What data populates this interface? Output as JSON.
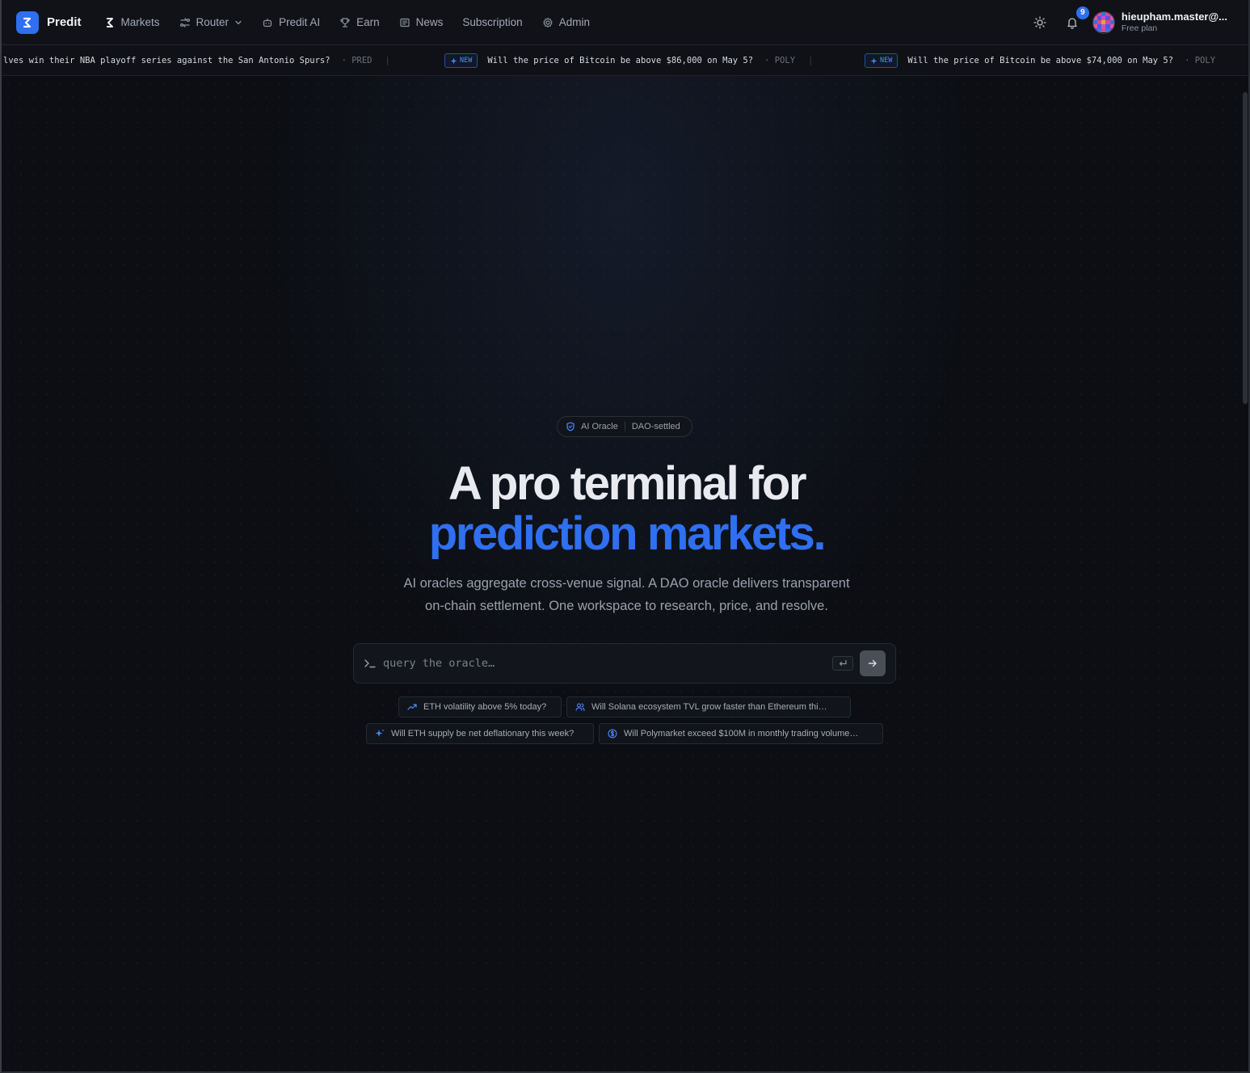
{
  "brand": {
    "name": "Predit",
    "color": "#2f6ff0"
  },
  "nav": {
    "items": [
      {
        "label": "Markets",
        "icon": "predit-mark-icon"
      },
      {
        "label": "Router",
        "icon": "router-icon",
        "dropdown": true
      },
      {
        "label": "Predit AI",
        "icon": "robot-icon"
      },
      {
        "label": "Earn",
        "icon": "trophy-icon"
      },
      {
        "label": "News",
        "icon": "newspaper-icon"
      },
      {
        "label": "Subscription",
        "icon": ""
      },
      {
        "label": "Admin",
        "icon": "gear-icon"
      }
    ]
  },
  "header": {
    "notifications_count": "9",
    "user_email": "hieupham.master@...",
    "user_plan": "Free plan"
  },
  "ticker": {
    "items": [
      {
        "new": false,
        "question": "lves win their NBA playoff series against the San Antonio Spurs?",
        "source": "· PRED"
      },
      {
        "new": true,
        "new_label": "NEW",
        "question": "Will the price of Bitcoin be above $86,000 on May 5?",
        "source": "· POLY"
      },
      {
        "new": true,
        "new_label": "NEW",
        "question": "Will the price of Bitcoin be above $74,000 on May 5?",
        "source": "· POLY"
      }
    ]
  },
  "hero": {
    "badge_left": "AI Oracle",
    "badge_right": "DAO-settled",
    "title_line1": "A pro terminal for",
    "title_line2": "prediction markets.",
    "subtitle_line1": "AI oracles aggregate cross-venue signal. A DAO oracle delivers transparent",
    "subtitle_line2": "on-chain settlement. One workspace to research, price, and resolve."
  },
  "query": {
    "placeholder": "query the oracle…",
    "value": ""
  },
  "suggestions": [
    {
      "label": "ETH volatility above 5% today?",
      "icon": "trend-up-icon"
    },
    {
      "label": "Will Solana ecosystem TVL grow faster than Ethereum thi…",
      "icon": "users-icon"
    },
    {
      "label": "Will ETH supply be net deflationary this week?",
      "icon": "sparkle-icon"
    },
    {
      "label": "Will Polymarket exceed $100M in monthly trading volume…",
      "icon": "dollar-circle-icon"
    }
  ]
}
